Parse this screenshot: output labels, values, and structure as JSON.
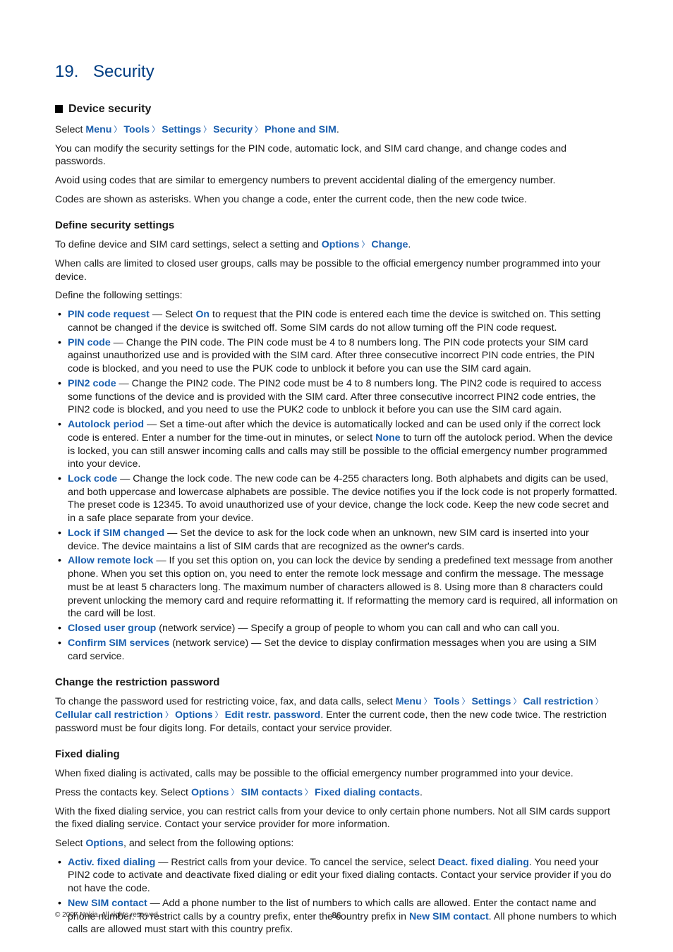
{
  "chapter": {
    "number": "19.",
    "title": "Security"
  },
  "h2_device_security": "Device security",
  "intro_select_prefix": "Select ",
  "nav": {
    "menu": "Menu",
    "tools": "Tools",
    "settings": "Settings",
    "security": "Security",
    "phone_and_sim": "Phone and SIM"
  },
  "intro_line1": "You can modify the security settings for the PIN code, automatic lock, and SIM card change, and change codes and passwords.",
  "intro_line2": "Avoid using codes that are similar to emergency numbers to prevent accidental dialing of the emergency number.",
  "intro_line3": "Codes are shown as asterisks. When you change a code, enter the current code, then the new code twice.",
  "h3_define": "Define security settings",
  "define_line_prefix": "To define device and SIM card settings, select a setting and ",
  "define_options": "Options",
  "define_change": "Change",
  "define_after": ".",
  "define_line2": "When calls are limited to closed user groups, calls may be possible to the official emergency number programmed into your device.",
  "define_intro_list": "Define the following settings:",
  "items": {
    "pin_req": {
      "term": "PIN code request",
      "mid": " — Select ",
      "on": "On",
      "rest": " to request that the PIN code is entered each time the device is switched on. This setting cannot be changed if the device is switched off. Some SIM cards do not allow turning off the PIN code request."
    },
    "pin_code": {
      "term": "PIN code",
      "rest": " — Change the PIN code. The PIN code must be 4 to 8 numbers long. The PIN code protects your SIM card against unauthorized use and is provided with the SIM card. After three consecutive incorrect PIN code entries, the PIN code is blocked, and you need to use the PUK code to unblock it before you can use the SIM card again."
    },
    "pin2": {
      "term": "PIN2 code",
      "rest": " — Change the PIN2 code. The PIN2 code must be 4 to 8 numbers long. The PIN2 code is required to access some functions of the device and is provided with the SIM card. After three consecutive incorrect PIN2 code entries, the PIN2 code is blocked, and you need to use the PUK2 code to unblock it before you can use the SIM card again."
    },
    "autolock": {
      "term": "Autolock period",
      "mid": "  — Set a time-out after which the device is automatically locked and can be used only if the correct lock code is entered. Enter a number for the time-out in minutes, or select ",
      "none": "None",
      "rest": " to turn off the autolock period. When the device is locked, you can still answer incoming calls and calls may still be possible to the official emergency number programmed into your device."
    },
    "lockcode": {
      "term": "Lock code",
      "rest": " — Change the lock code. The new code can be 4-255 characters long. Both alphabets and digits can be used, and both uppercase and lowercase alphabets are possible. The device notifies you if the lock code is not properly formatted. The preset code is 12345. To avoid unauthorized use of your device, change the lock code. Keep the new code secret and in a safe place separate from your device."
    },
    "locksim": {
      "term": "Lock if SIM changed",
      "rest": " — Set the device to ask for the lock code when an unknown, new SIM card is inserted into your device. The device maintains a list of SIM cards that are recognized as the owner's cards."
    },
    "remote": {
      "term": "Allow remote lock",
      "rest": " — If you set this option on, you can lock the device by sending a predefined text message from another phone. When you set this option on, you need to enter the remote lock message and confirm the message. The message must be at least 5 characters long. The maximum number of characters allowed is 8. Using more than 8 characters could prevent unlocking the memory card and require reformatting it. If reformatting the memory card is required, all information on the card will be lost."
    },
    "closed": {
      "term": "Closed user group",
      "rest": " (network service) — Specify a group of people to whom you can call and who can call you."
    },
    "confirm": {
      "term": "Confirm SIM services",
      "rest": " (network service) — Set the device to display confirmation messages when you are using a SIM card service."
    }
  },
  "h3_change_pw": "Change the restriction password",
  "pw_prefix": "To change the password used for restricting voice, fax, and data calls, select ",
  "pw_nav": {
    "menu": "Menu",
    "tools": "Tools",
    "settings": "Settings",
    "call_restriction": "Call restriction",
    "cellular": "Cellular call restriction",
    "options": "Options",
    "edit": "Edit restr. password"
  },
  "pw_suffix": ". Enter the current code, then the new code twice. The restriction password must be four digits long. For details, contact your service provider.",
  "h3_fixed": "Fixed dialing",
  "fixed_line1": "When fixed dialing is activated, calls may be possible to the official emergency number programmed into your device.",
  "fixed_press_prefix": "Press the contacts key. Select ",
  "fixed_nav": {
    "options": "Options",
    "sim_contacts": "SIM contacts",
    "fixed_contacts": "Fixed dialing contacts"
  },
  "fixed_line3": "With the fixed dialing service, you can restrict calls from your device to only certain phone numbers. Not all SIM cards support the fixed dialing service. Contact your service provider for more information.",
  "fixed_select_prefix": "Select ",
  "fixed_options": "Options",
  "fixed_select_suffix": ", and select from the following options:",
  "fixed_items": {
    "activ": {
      "term": "Activ. fixed dialing",
      "mid": " — Restrict calls from your device. To cancel the service, select ",
      "deact": "Deact. fixed dialing",
      "rest": ". You need your PIN2 code to activate and deactivate fixed dialing or edit your fixed dialing contacts. Contact your service provider if you do not have the code."
    },
    "newsim": {
      "term": "New SIM contact",
      "mid": " — Add a phone number to the list of numbers to which calls are allowed. Enter the contact name and phone number. To restrict calls by a country prefix, enter the country prefix in ",
      "term2": "New SIM contact",
      "rest": ". All phone numbers to which calls are allowed must start with this country prefix."
    }
  },
  "footer": {
    "copyright": "© 2007 Nokia. All rights reserved.",
    "page": "86"
  }
}
